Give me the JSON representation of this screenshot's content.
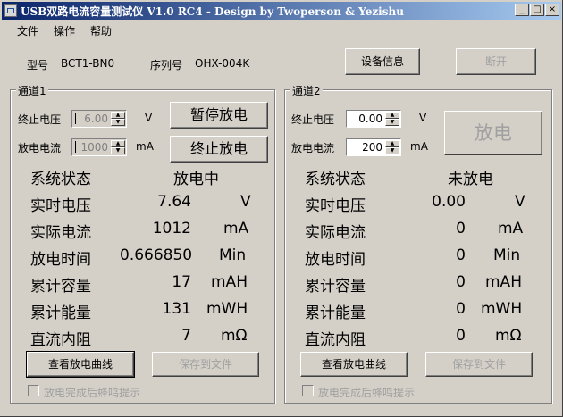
{
  "window": {
    "title": "USB双路电流容量测试仪 V1.0 RC4 - Design by Twoperson & Yezishu"
  },
  "menu": [
    "文件",
    "操作",
    "帮助"
  ],
  "device": {
    "model_label": "型号",
    "model_value": "BCT1-BN0",
    "serial_label": "序列号",
    "serial_value": "OHX-004K",
    "info_button": "设备信息",
    "disconnect_button": "断开"
  },
  "ch1": {
    "title": "通道1",
    "stop_voltage_label": "终止电压",
    "stop_voltage_value": "6.00",
    "stop_voltage_unit": "V",
    "current_label": "放电电流",
    "current_value": "1000",
    "current_unit": "mA",
    "pause_button": "暂停放电",
    "stop_button": "终止放电",
    "status_label": "系统状态",
    "status_value": "放电中",
    "rows": [
      {
        "label": "实时电压",
        "value": "7.64",
        "unit": "V"
      },
      {
        "label": "实际电流",
        "value": "1012",
        "unit": "mA"
      },
      {
        "label": "放电时间",
        "value": "0.666850",
        "unit": "Min"
      },
      {
        "label": "累计容量",
        "value": "17",
        "unit": "mAH"
      },
      {
        "label": "累计能量",
        "value": "131",
        "unit": "mWH"
      },
      {
        "label": "直流内阻",
        "value": "7",
        "unit": "mΩ"
      }
    ],
    "curve_button": "查看放电曲线",
    "save_button": "保存到文件",
    "beep_label": "放电完成后蜂鸣提示"
  },
  "ch2": {
    "title": "通道2",
    "stop_voltage_label": "终止电压",
    "stop_voltage_value": "0.00",
    "stop_voltage_unit": "V",
    "current_label": "放电电流",
    "current_value": "200",
    "current_unit": "mA",
    "discharge_button": "放电",
    "status_label": "系统状态",
    "status_value": "未放电",
    "rows": [
      {
        "label": "实时电压",
        "value": "0.00",
        "unit": "V"
      },
      {
        "label": "实际电流",
        "value": "0",
        "unit": "mA"
      },
      {
        "label": "放电时间",
        "value": "0",
        "unit": "Min"
      },
      {
        "label": "累计容量",
        "value": "0",
        "unit": "mAH"
      },
      {
        "label": "累计能量",
        "value": "0",
        "unit": "mWH"
      },
      {
        "label": "直流内阻",
        "value": "0",
        "unit": "mΩ"
      }
    ],
    "curve_button": "查看放电曲线",
    "save_button": "保存到文件",
    "beep_label": "放电完成后蜂鸣提示"
  },
  "colors": {
    "face": "#d4d0c8",
    "title_start": "#0a246a",
    "title_end": "#a6caf0",
    "disabled_text": "#a0a0a0"
  }
}
